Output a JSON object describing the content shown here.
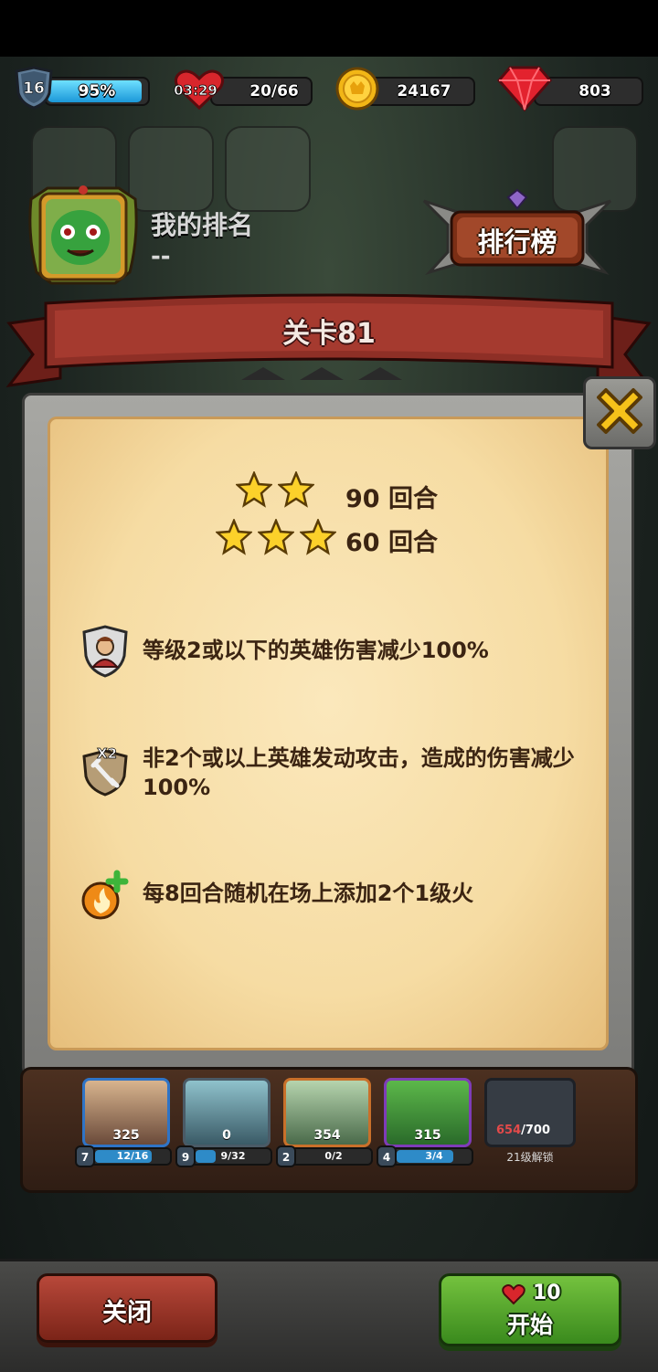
{
  "top_bar": {
    "level": "16",
    "xp_percent_text": "95%",
    "xp_fraction": 0.95,
    "energy_timer": "03:29",
    "energy": "20/66",
    "coins": "24167",
    "gems": "803"
  },
  "profile": {
    "rank_label": "我的排名",
    "rank_value": "--"
  },
  "leaderboard_button": "排行榜",
  "stage": {
    "title": "关卡81",
    "two_star_rounds": "90 回合",
    "three_star_rounds": "60 回合"
  },
  "rules": [
    {
      "icon": "hero-shield-icon",
      "text": "等级2或以下的英雄伤害减少100%"
    },
    {
      "icon": "sword-x2-icon",
      "text": "非2个或以上英雄发动攻击，造成的伤害减少100%"
    },
    {
      "icon": "fire-plus-icon",
      "text": "每8回合随机在场上添加2个1级火"
    }
  ],
  "heroes": [
    {
      "power": "325",
      "level": "7",
      "progress": "12/16",
      "fill": 0.75,
      "color": "#2f74c6"
    },
    {
      "power": "0",
      "level": "9",
      "progress": "9/32",
      "fill": 0.28,
      "color": "#4a5a66"
    },
    {
      "power": "354",
      "level": "2",
      "progress": "0/2",
      "fill": 0.0,
      "color": "#c9702a"
    },
    {
      "power": "315",
      "level": "4",
      "progress": "3/4",
      "fill": 0.75,
      "color": "#7e3cb8"
    }
  ],
  "locked_slot": {
    "current": "654",
    "required": "/700",
    "label": "21级解锁"
  },
  "buttons": {
    "close": "关闭",
    "start_cost": "10",
    "start": "开始"
  },
  "colors": {
    "parchment": "#f6dca3",
    "banner": "#8a2a22",
    "start_green": "#4fa02a",
    "close_red": "#9b3426"
  }
}
